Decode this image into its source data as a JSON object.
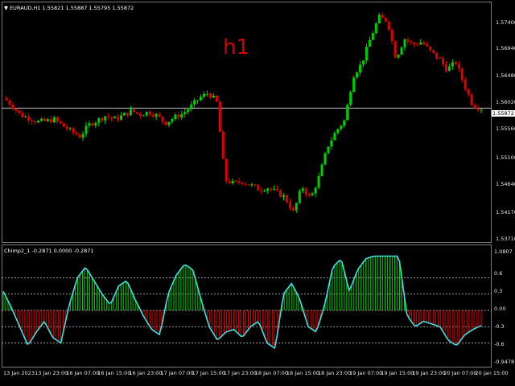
{
  "main": {
    "symbol_title": "EURAUD,H1  1.55821 1.55887 1.55795 1.55872",
    "timeframe_label": "h1",
    "current_price": "1.55872",
    "price_ticks": [
      "1.57400",
      "1.56940",
      "1.56480",
      "1.56020",
      "1.55560",
      "1.55100",
      "1.54640",
      "1.54170",
      "1.53710"
    ]
  },
  "indicator": {
    "title": "Chimp2_1 -0.2871 0.0000 -0.2871",
    "ticks": [
      "1.0807",
      "0.6",
      "0.3",
      "0.00",
      "-0.3",
      "-0.6",
      "-0.9478"
    ]
  },
  "time_axis": {
    "labels": [
      "13 Jan 2023",
      "13 Jan 23:00",
      "16 Jan 07:00",
      "16 Jan 15:00",
      "16 Jan 23:00",
      "17 Jan 07:00",
      "17 Jan 15:00",
      "17 Jan 23:00",
      "18 Jan 07:00",
      "18 Jan 15:00",
      "18 Jan 23:00",
      "19 Jan 07:00",
      "19 Jan 15:00",
      "19 Jan 23:00",
      "20 Jan 07:00",
      "20 Jan 15:00"
    ]
  },
  "colors": {
    "bull": "#00cc00",
    "bear": "#e00000",
    "line": "#40e0e0",
    "grid": "#cfcfcf"
  },
  "chart_data": [
    {
      "type": "candlestick",
      "title": "EURAUD,H1",
      "ylim": [
        1.5371,
        1.5755
      ],
      "close_path": [
        1.5604,
        1.5592,
        1.5576,
        1.5571,
        1.5565,
        1.5566,
        1.5569,
        1.5558,
        1.5549,
        1.5541,
        1.556,
        1.5567,
        1.5575,
        1.5569,
        1.5575,
        1.5583,
        1.5577,
        1.5581,
        1.5575,
        1.5563,
        1.5572,
        1.5578,
        1.559,
        1.5604,
        1.5612,
        1.5598,
        1.547,
        1.5465,
        1.5468,
        1.5462,
        1.5455,
        1.5458,
        1.5451,
        1.5442,
        1.5418,
        1.546,
        1.544,
        1.5476,
        1.5525,
        1.555,
        1.5568,
        1.564,
        1.566,
        1.57,
        1.5735,
        1.5729,
        1.5668,
        1.57,
        1.569,
        1.5695,
        1.568,
        1.5668,
        1.565,
        1.5662,
        1.5625,
        1.5592,
        1.5587
      ]
    },
    {
      "type": "histogram+line",
      "title": "Chimp2_1",
      "ylim": [
        -0.9478,
        1.0807
      ],
      "levels": [
        0.6,
        0.3,
        0.0,
        -0.3,
        -0.6
      ],
      "values": [
        0.35,
        0.05,
        -0.3,
        -0.65,
        -0.4,
        -0.2,
        -0.5,
        -0.6,
        0.1,
        0.6,
        0.8,
        0.55,
        0.3,
        0.1,
        0.45,
        0.55,
        0.2,
        -0.1,
        -0.35,
        -0.45,
        0.3,
        0.65,
        0.85,
        0.75,
        0.2,
        -0.3,
        -0.55,
        -0.4,
        -0.35,
        -0.5,
        -0.3,
        -0.2,
        -0.6,
        -0.7,
        0.3,
        0.5,
        0.2,
        -0.3,
        -0.4,
        0.1,
        0.8,
        0.95,
        0.35,
        0.75,
        0.95,
        1.0,
        1.0,
        1.0,
        1.0,
        -0.1,
        -0.3,
        -0.2,
        -0.25,
        -0.3,
        -0.55,
        -0.65,
        -0.45,
        -0.35,
        -0.28
      ]
    }
  ]
}
